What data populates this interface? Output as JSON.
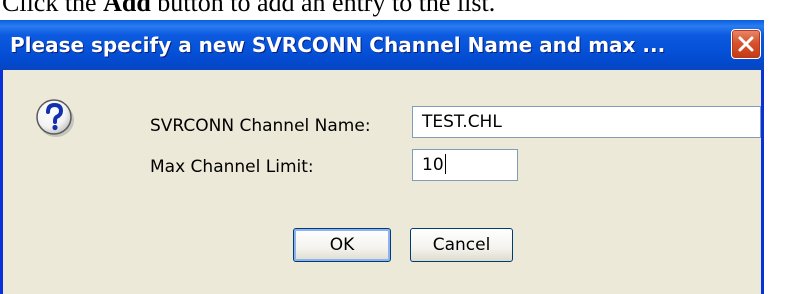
{
  "page": {
    "instruction_prefix": "Click the ",
    "instruction_bold": "Add",
    "instruction_suffix": " button to add an entry to the list."
  },
  "dialog": {
    "title": "Please specify a new SVRCONN Channel Name and max ...",
    "channel_name_label": "SVRCONN Channel Name:",
    "channel_name_value": "TEST.CHL",
    "max_limit_label": "Max Channel Limit:",
    "max_limit_value": "10",
    "ok_label": "OK",
    "cancel_label": "Cancel"
  },
  "icons": {
    "close": "close-icon",
    "help": "question-icon"
  },
  "colors": {
    "titlebar": "#0552d9",
    "close_button": "#d7532e",
    "dialog_bg": "#ece9d8"
  }
}
